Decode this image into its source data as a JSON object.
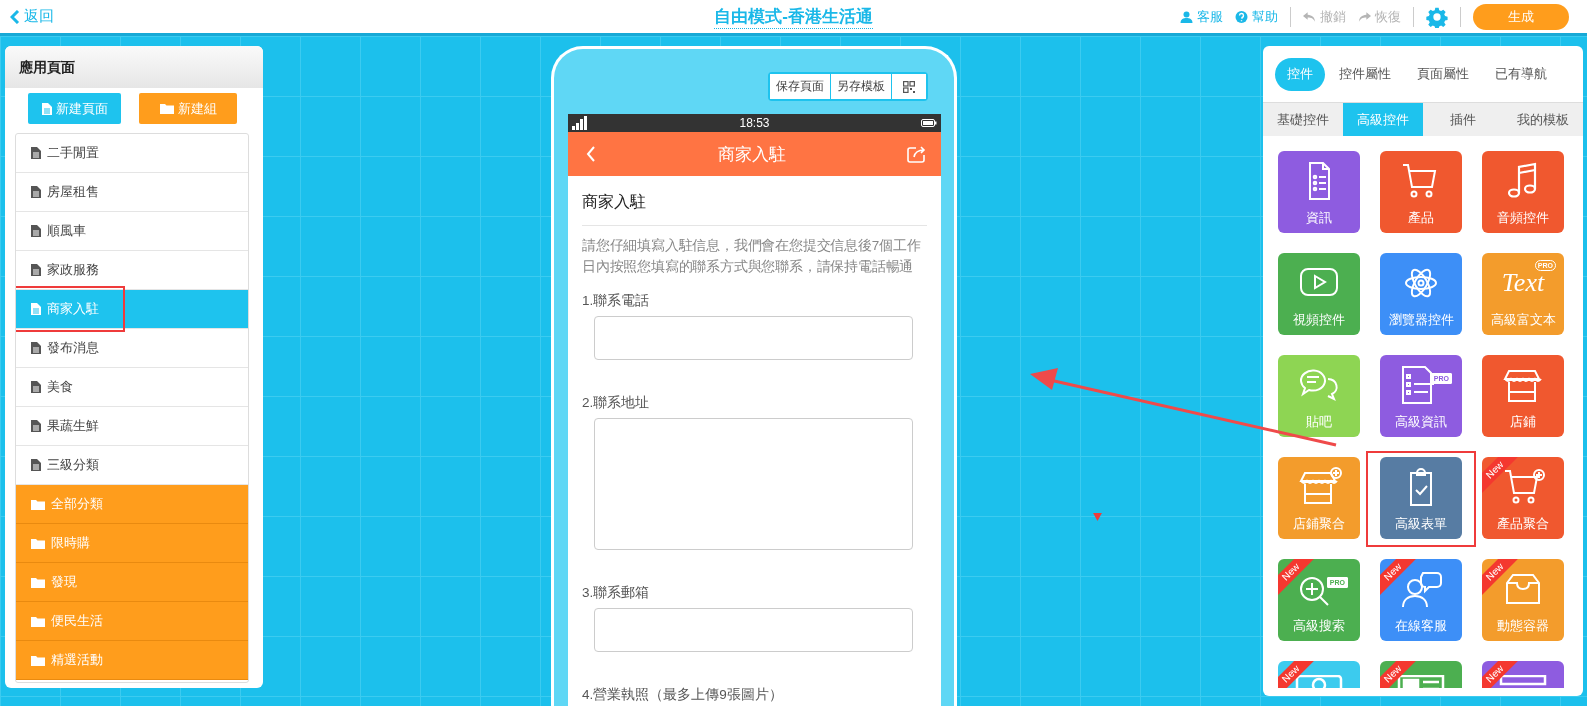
{
  "topbar": {
    "back": "返回",
    "title": "自由模式-香港生活通",
    "actions": [
      {
        "kind": "service",
        "label": "客服",
        "disabled": false
      },
      {
        "kind": "help",
        "label": "幫助",
        "disabled": false
      },
      {
        "kind": "undo",
        "label": "撤銷",
        "disabled": true
      },
      {
        "kind": "redo",
        "label": "恢復",
        "disabled": true
      }
    ],
    "generate": "生成"
  },
  "pages_panel": {
    "title": "應用頁面",
    "new_page": "新建頁面",
    "new_group": "新建組",
    "items": [
      {
        "kind": "page",
        "label": "二手閒置",
        "selected": false,
        "annotated": false
      },
      {
        "kind": "page",
        "label": "房屋租售",
        "selected": false,
        "annotated": false
      },
      {
        "kind": "page",
        "label": "順風車",
        "selected": false,
        "annotated": false
      },
      {
        "kind": "page",
        "label": "家政服務",
        "selected": false,
        "annotated": false
      },
      {
        "kind": "page",
        "label": "商家入駐",
        "selected": true,
        "annotated": true
      },
      {
        "kind": "page",
        "label": "發布消息",
        "selected": false,
        "annotated": false
      },
      {
        "kind": "page",
        "label": "美食",
        "selected": false,
        "annotated": false
      },
      {
        "kind": "page",
        "label": "果蔬生鮮",
        "selected": false,
        "annotated": false
      },
      {
        "kind": "page",
        "label": "三級分類",
        "selected": false,
        "annotated": false
      },
      {
        "kind": "group",
        "label": "全部分類",
        "selected": false,
        "annotated": false
      },
      {
        "kind": "group",
        "label": "限時購",
        "selected": false,
        "annotated": false
      },
      {
        "kind": "group",
        "label": "發現",
        "selected": false,
        "annotated": false
      },
      {
        "kind": "group",
        "label": "便民生活",
        "selected": false,
        "annotated": false
      },
      {
        "kind": "group",
        "label": "精選活動",
        "selected": false,
        "annotated": false
      }
    ]
  },
  "phone": {
    "buttons": [
      "保存頁面",
      "另存模板"
    ],
    "time": "18:53",
    "header_title": "商家入駐",
    "form": {
      "title": "商家入駐",
      "description": "請您仔細填寫入駐信息，我們會在您提交信息後7個工作日內按照您填寫的聯系方式與您聯系，請保持電話暢通",
      "fields": [
        {
          "kind": "input",
          "label": "1.聯系電話"
        },
        {
          "kind": "textarea",
          "label": "2.聯系地址"
        },
        {
          "kind": "input",
          "label": "3.聯系郵箱"
        },
        {
          "kind": "upload",
          "label": "4.營業執照（最多上傳9張圖片）"
        }
      ]
    }
  },
  "widgets_panel": {
    "tabs": [
      {
        "label": "控件",
        "selected": true
      },
      {
        "label": "控件屬性",
        "selected": false
      },
      {
        "label": "頁面屬性",
        "selected": false
      },
      {
        "label": "已有導航",
        "selected": false
      }
    ],
    "subtabs": [
      {
        "label": "基礎控件",
        "selected": false
      },
      {
        "label": "高級控件",
        "selected": true
      },
      {
        "label": "插件",
        "selected": false
      },
      {
        "label": "我的模板",
        "selected": false
      }
    ],
    "tiles": [
      {
        "label": "資訊",
        "color": "#8e5ce0",
        "annotated": false
      },
      {
        "label": "產品",
        "color": "#f0582f",
        "annotated": false
      },
      {
        "label": "音頻控件",
        "color": "#f0582f",
        "annotated": false
      },
      {
        "label": "視頻控件",
        "color": "#4caf50",
        "annotated": false
      },
      {
        "label": "瀏覽器控件",
        "color": "#3d8ff7",
        "annotated": false
      },
      {
        "label": "高級富文本",
        "icon_text": "Text",
        "badge": "PRO",
        "color": "#f39c2c",
        "annotated": false
      },
      {
        "label": "貼吧",
        "color": "#8ed553",
        "annotated": false
      },
      {
        "label": "高級資訊",
        "badge": "PRO",
        "color": "#8e5ce0",
        "annotated": false
      },
      {
        "label": "店鋪",
        "color": "#f0582f",
        "annotated": false
      },
      {
        "label": "店鋪聚合",
        "color": "#f39c2c",
        "annotated": false
      },
      {
        "label": "高級表單",
        "color": "#577ca3",
        "annotated": true
      },
      {
        "label": "產品聚合",
        "ribbon": "New",
        "color": "#f0582f",
        "annotated": false
      },
      {
        "label": "高級搜索",
        "badge": "PRO",
        "ribbon": "New",
        "color": "#4caf50",
        "annotated": false
      },
      {
        "label": "在線客服",
        "ribbon": "New",
        "color": "#3d8ff7",
        "annotated": false
      },
      {
        "label": "動態容器",
        "ribbon": "New",
        "color": "#f39c2c",
        "annotated": false
      },
      {
        "ribbon": "New",
        "color": "#3ccbee",
        "annotated": false
      },
      {
        "ribbon": "New",
        "color": "#4caf50",
        "annotated": false
      },
      {
        "ribbon": "New",
        "color": "#8e5ce0",
        "annotated": false
      }
    ]
  }
}
